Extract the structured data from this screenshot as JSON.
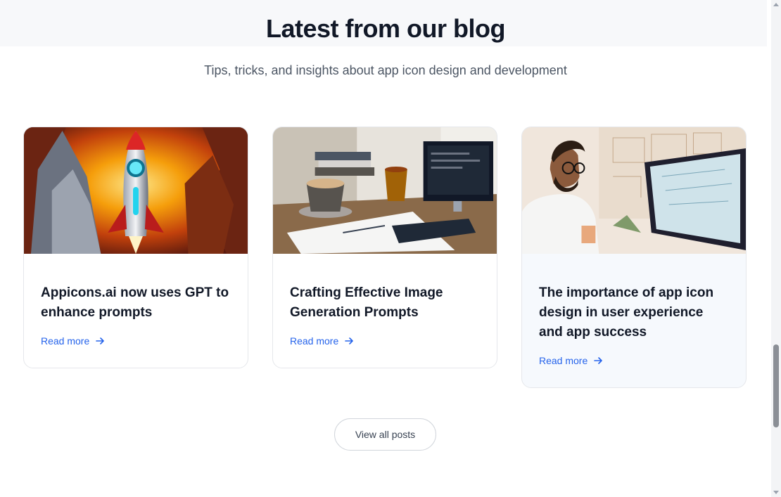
{
  "section": {
    "title": "Latest from our blog",
    "subtitle": "Tips, tricks, and insights about app icon design and development"
  },
  "posts": [
    {
      "title": "Appicons.ai now uses GPT to enhance prompts",
      "read_more": "Read more",
      "image_icon": "rocket-illustration"
    },
    {
      "title": "Crafting Effective Image Generation Prompts",
      "read_more": "Read more",
      "image_icon": "desk-workspace-photo"
    },
    {
      "title": "The importance of app icon design in user experience and app success",
      "read_more": "Read more",
      "image_icon": "designer-illustration"
    }
  ],
  "view_all_label": "View all posts",
  "colors": {
    "link": "#2563eb",
    "heading": "#111827",
    "subtitle": "#4b5563",
    "card_border": "#e5e7eb",
    "hover_card_bg": "#f6f9fd"
  }
}
